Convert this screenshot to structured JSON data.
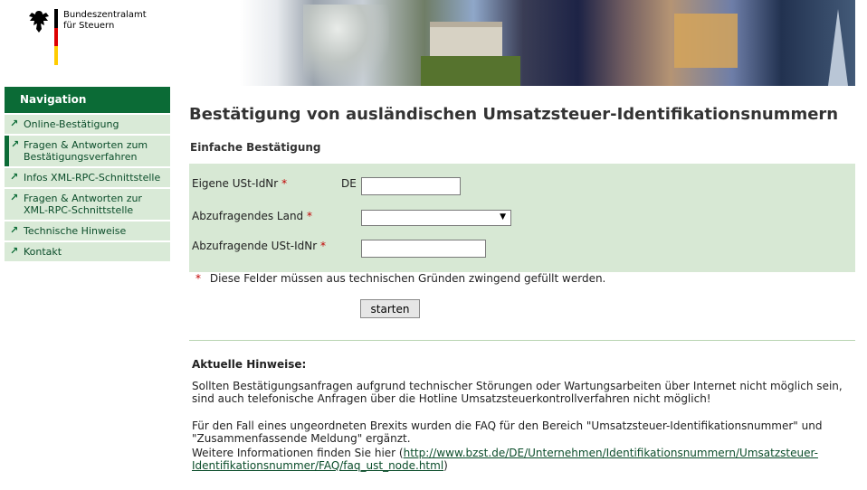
{
  "header": {
    "org_line1": "Bundeszentralamt",
    "org_line2": "für Steuern"
  },
  "nav": {
    "title": "Navigation",
    "items": [
      {
        "label": "Online-Bestätigung"
      },
      {
        "label": "Fragen & Antworten zum Bestätigungsverfahren"
      },
      {
        "label": "Infos XML-RPC-Schnittstelle"
      },
      {
        "label": "Fragen & Antworten zur XML-RPC-Schnittstelle"
      },
      {
        "label": "Technische Hinweise"
      },
      {
        "label": "Kontakt"
      }
    ]
  },
  "main": {
    "title": "Bestätigung von ausländischen Umsatzsteuer-Identifikationsnummern",
    "section_title": "Einfache Bestätigung",
    "form": {
      "own_label": "Eigene USt-IdNr",
      "own_prefix": "DE",
      "own_value": "",
      "country_label": "Abzufragendes Land",
      "country_value": "",
      "query_label": "Abzufragende USt-IdNr",
      "query_value": "",
      "required_mark": "*",
      "required_note": "Diese Felder müssen aus technischen Gründen zwingend gefüllt werden.",
      "submit_label": "starten"
    },
    "hints": {
      "title": "Aktuelle Hinweise:",
      "p1": "Sollten Bestätigungsanfragen aufgrund technischer Störungen oder Wartungsarbeiten über Internet nicht möglich sein, sind auch telefonische Anfragen über die Hotline Umsatzsteuerkontrollverfahren nicht möglich!",
      "p2": "Für den Fall eines ungeordneten Brexits wurden die FAQ für den Bereich \"Umsatzsteuer-Identifikationsnummer\" und \"Zusammenfassende Meldung\" ergänzt.",
      "p3_prefix": "Weitere Informationen finden Sie hier (",
      "p3_link": "http://www.bzst.de/DE/Unternehmen/Identifikationsnummern/Umsatzsteuer-Identifikationsnummer/FAQ/faq_ust_node.html",
      "p3_suffix": ")"
    }
  },
  "colors": {
    "nav_green": "#0b6b36",
    "nav_item_bg": "#d9ead7",
    "form_bg": "#d7e8d4",
    "required_red": "#c00000"
  },
  "icons": {
    "logo": "federal-eagle-icon",
    "nav_arrow": "arrow-up-right-icon",
    "select_caret": "caret-down-icon"
  }
}
